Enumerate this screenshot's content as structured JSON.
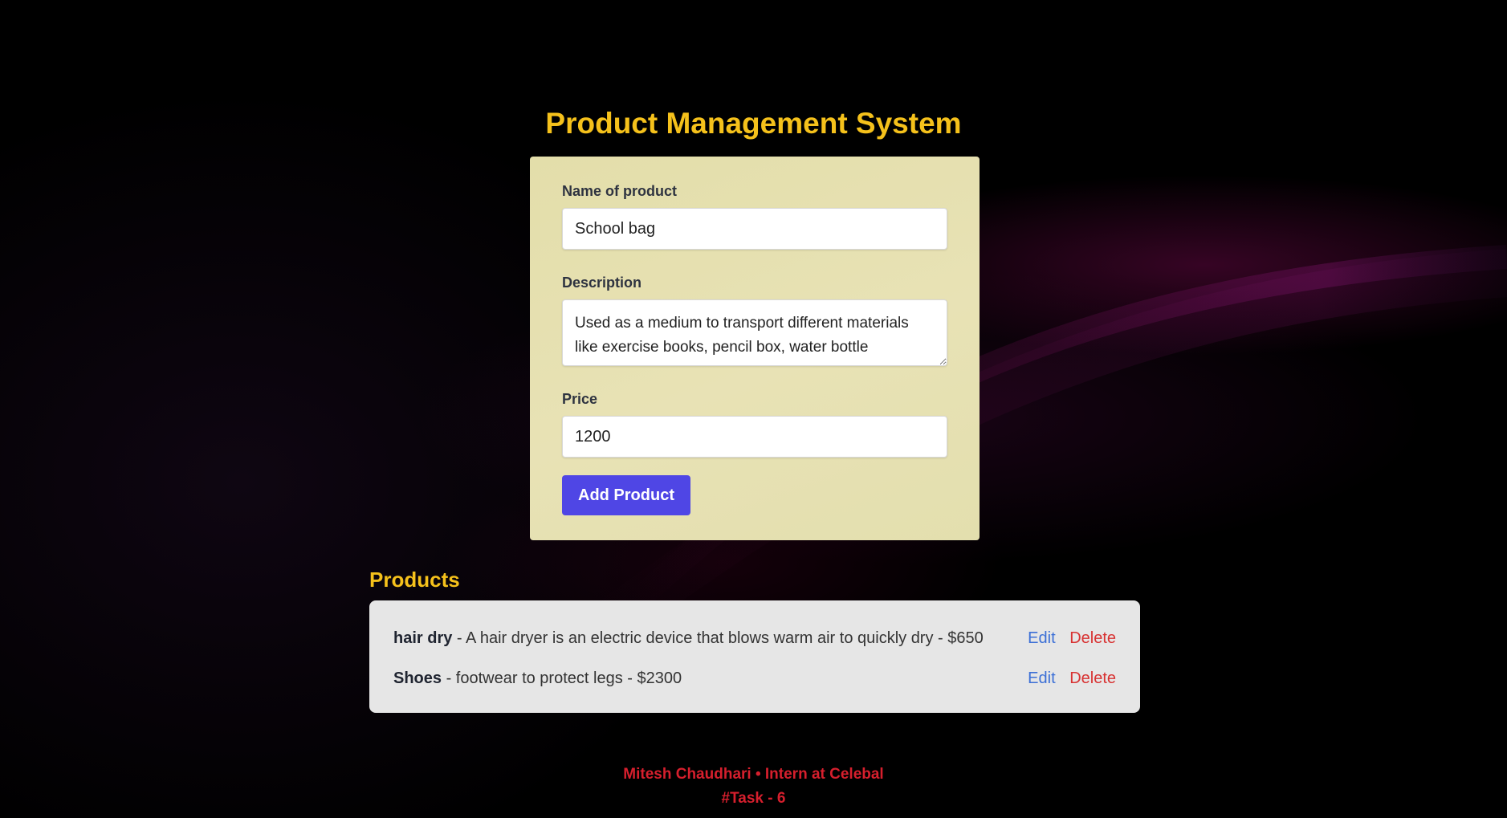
{
  "page": {
    "title": "Product Management System"
  },
  "form": {
    "name_label": "Name of product",
    "name_value": "School bag",
    "description_label": "Description",
    "description_value": "Used as a medium to transport different materials like exercise books, pencil box, water bottle",
    "price_label": "Price",
    "price_value": "1200",
    "submit_label": "Add Product"
  },
  "products": {
    "heading": "Products",
    "items": [
      {
        "name": "hair dry",
        "detail": " - A hair dryer is an electric device that blows warm air to quickly dry - $650",
        "edit_label": "Edit",
        "delete_label": "Delete"
      },
      {
        "name": "Shoes",
        "detail": " - footwear to protect legs - $2300",
        "edit_label": "Edit",
        "delete_label": "Delete"
      }
    ]
  },
  "footer": {
    "line1": "Mitesh Chaudhari • Intern at Celebal",
    "line2": "#Task - 6"
  },
  "colors": {
    "accent_yellow": "#f5c11b",
    "button_indigo": "#4f46e5",
    "edit_blue": "#3b6fd6",
    "delete_red": "#d83232",
    "footer_red": "#d61f2d"
  }
}
